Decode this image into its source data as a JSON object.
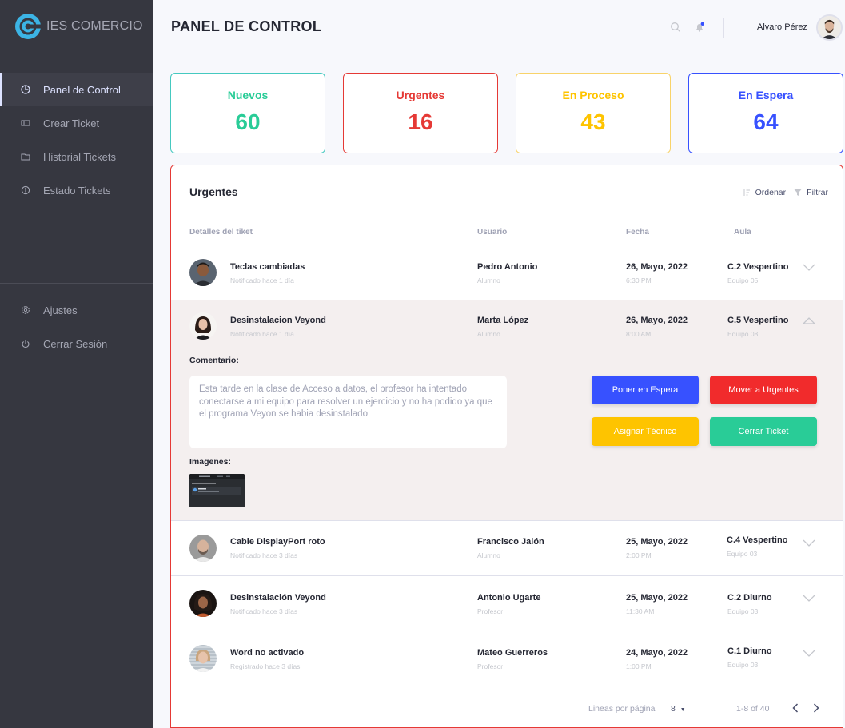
{
  "app": {
    "brand_name": "IES COMERCIO",
    "accent": "#3751ff"
  },
  "sidebar": {
    "items": [
      {
        "label": "Panel de Control",
        "icon": "dashboard-icon"
      },
      {
        "label": "Crear Ticket",
        "icon": "ticket-icon"
      },
      {
        "label": "Historial Tickets",
        "icon": "folder-icon"
      },
      {
        "label": "Estado Tickets",
        "icon": "info-icon"
      }
    ],
    "bottom_items": [
      {
        "label": "Ajustes",
        "icon": "gear-icon"
      },
      {
        "label": "Cerrar Sesión",
        "icon": "power-icon"
      }
    ]
  },
  "header": {
    "title": "PANEL DE CONTROL",
    "user_name": "Alvaro Pérez"
  },
  "stats": [
    {
      "label": "Nuevos",
      "value": "60",
      "color": "#29cc97"
    },
    {
      "label": "Urgentes",
      "value": "16",
      "color": "#e53935"
    },
    {
      "label": "En Proceso",
      "value": "43",
      "color": "#fec400"
    },
    {
      "label": "En Espera",
      "value": "64",
      "color": "#3751ff"
    }
  ],
  "panel": {
    "title": "Urgentes",
    "sort_label": "Ordenar",
    "filter_label": "Filtrar",
    "columns": [
      "Detalles del tiket",
      "Usuario",
      "Fecha",
      "Aula"
    ],
    "rows": [
      {
        "title": "Teclas cambiadas",
        "sub": "Notificado hace 1 día",
        "user": "Pedro Antonio",
        "role": "Alumno",
        "date": "26, Mayo, 2022",
        "time": "6:30 PM",
        "aula": "C.2 Vespertino",
        "equipo": "Equipo 05"
      },
      {
        "title": "Desinstalacion Veyond",
        "sub": "Notificado hace 1 día",
        "user": "Marta López",
        "role": "Alumno",
        "date": "26, Mayo, 2022",
        "time": "8:00 AM",
        "aula": "C.5 Vespertino",
        "equipo": "Equipo 08"
      },
      {
        "title": "Cable DisplayPort roto",
        "sub": "Notificado hace 3 días",
        "user": "Francisco Jalón",
        "role": "Alumno",
        "date": "25, Mayo, 2022",
        "time": "2:00 PM",
        "aula": "C.4 Vespertino",
        "equipo": "Equipo 03"
      },
      {
        "title": "Desinstalación Veyond",
        "sub": "Notificado hace 3 días",
        "user": "Antonio Ugarte",
        "role": "Profesor",
        "date": "25, Mayo, 2022",
        "time": "11:30 AM",
        "aula": "C.2 Diurno",
        "equipo": "Equipo 03"
      },
      {
        "title": "Word no activado",
        "sub": "Registrado hace 3 días",
        "user": "Mateo Guerreros",
        "role": "Profesor",
        "date": "24, Mayo, 2022",
        "time": "1:00 PM",
        "aula": "C.1 Diurno",
        "equipo": "Equipo 03"
      }
    ],
    "expanded": {
      "comment_label": "Comentario:",
      "comment": "Esta tarde en la clase de Acceso a datos, el profesor ha intentado conectarse a mi equipo para resolver un ejercicio y no ha podido ya que el programa Veyon se habia desinstalado",
      "images_label": "Imagenes:",
      "buttons": [
        {
          "label": "Poner en Espera",
          "color": "#3751ff"
        },
        {
          "label": "Mover a Urgentes",
          "color": "#f12b2c"
        },
        {
          "label": "Asignar Técnico",
          "color": "#fec400"
        },
        {
          "label": "Cerrar Ticket",
          "color": "#29cc97"
        }
      ]
    },
    "pagination": {
      "rows_label": "Lineas por página",
      "rows_value": "8",
      "range": "1-8 of 40"
    }
  }
}
